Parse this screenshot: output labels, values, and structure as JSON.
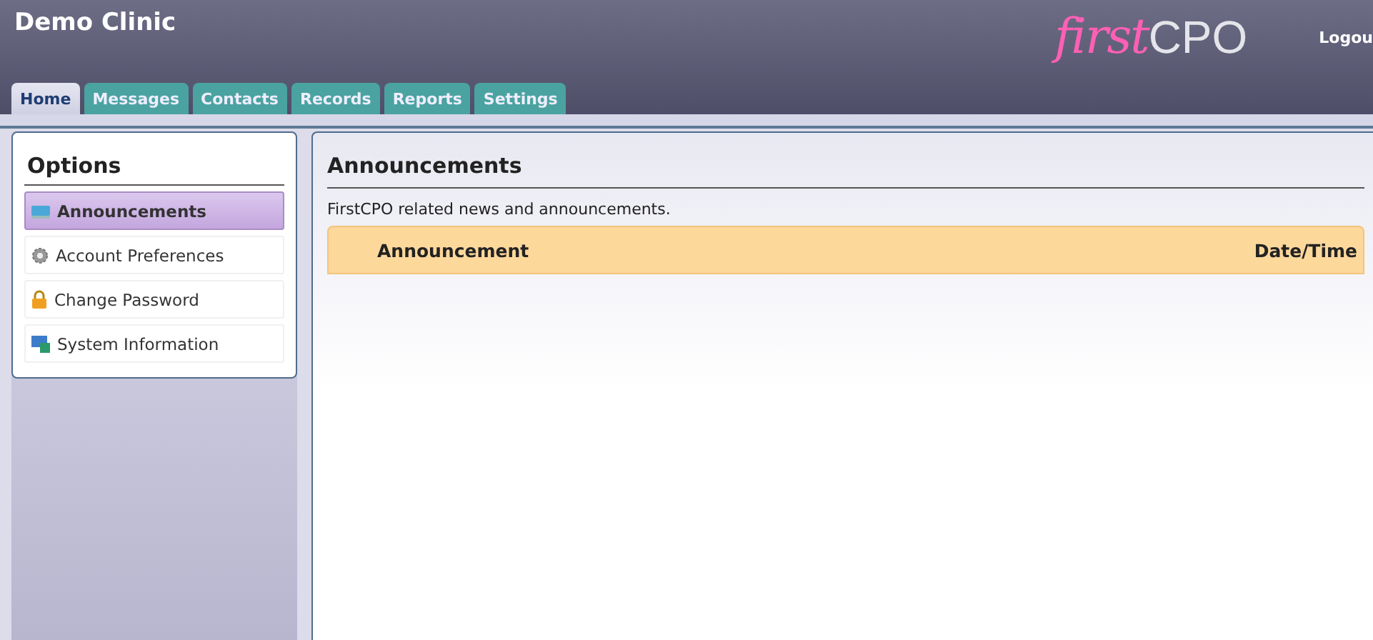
{
  "header": {
    "title": "Demo Clinic",
    "logo": {
      "script": "first",
      "letters": "CPO"
    },
    "logout": "Logou"
  },
  "tabs": [
    {
      "label": "Home",
      "selected": true
    },
    {
      "label": "Messages",
      "selected": false
    },
    {
      "label": "Contacts",
      "selected": false
    },
    {
      "label": "Records",
      "selected": false
    },
    {
      "label": "Reports",
      "selected": false
    },
    {
      "label": "Settings",
      "selected": false
    }
  ],
  "sidebar": {
    "title": "Options",
    "items": [
      {
        "label": "Announcements",
        "kind": "monitor",
        "selected": true
      },
      {
        "label": "Account Preferences",
        "kind": "gear",
        "selected": false
      },
      {
        "label": "Change Password",
        "kind": "lock",
        "selected": false
      },
      {
        "label": "System Information",
        "kind": "computer",
        "selected": false
      }
    ]
  },
  "main": {
    "title": "Announcements",
    "description": "FirstCPO related news and announcements.",
    "table": {
      "columns": [
        "Announcement",
        "Date/Time"
      ]
    }
  }
}
